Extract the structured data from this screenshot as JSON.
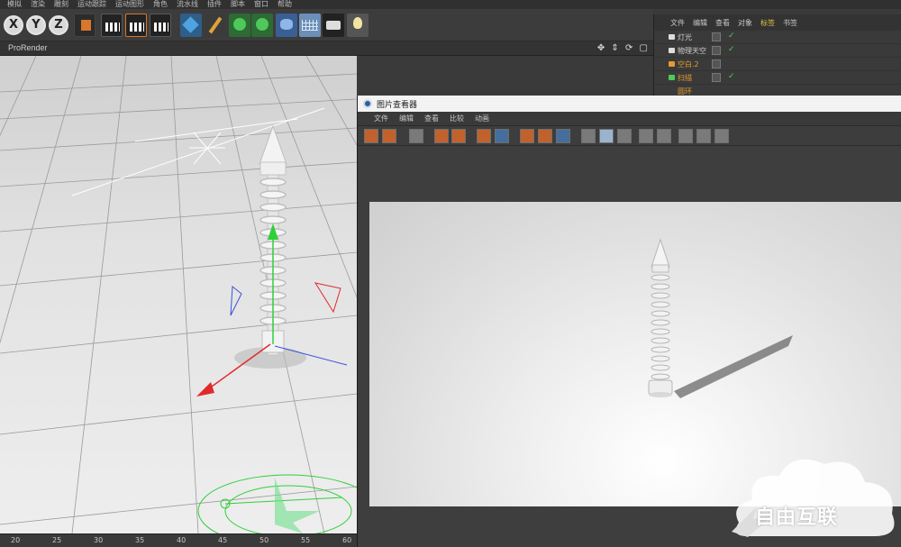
{
  "menubar": {
    "items": [
      "模拟",
      "渲染",
      "雕刻",
      "运动跟踪",
      "运动图形",
      "角色",
      "流水线",
      "插件",
      "脚本",
      "窗口",
      "帮助"
    ]
  },
  "toolbar": {
    "axis_x": "X",
    "axis_y": "Y",
    "axis_z": "Z",
    "icons": [
      "coordinate-system-icon",
      "render-view-icon",
      "render-picture-viewer-icon",
      "render-settings-icon",
      "cube-icon",
      "pen-icon",
      "subdivision-icon",
      "array-icon",
      "deformer-icon",
      "floor-icon",
      "camera-icon",
      "light-icon"
    ]
  },
  "viewport": {
    "title": "ProRender",
    "controls": "✥ ⇕ ⟳ ▢"
  },
  "ruler": {
    "ticks": [
      "20",
      "25",
      "30",
      "35",
      "40",
      "45",
      "50",
      "55",
      "60"
    ]
  },
  "object_manager": {
    "menu": [
      "文件",
      "编辑",
      "查看",
      "对象",
      "标签",
      "书签"
    ],
    "active_menu": "标签",
    "rows": [
      {
        "name": "灯光",
        "orange": false
      },
      {
        "name": "物理天空",
        "orange": false
      },
      {
        "name": "空白.2",
        "orange": true
      },
      {
        "name": "扫描",
        "orange": true
      },
      {
        "name": "圆环",
        "orange": true
      }
    ]
  },
  "picture_viewer": {
    "title": "图片查看器",
    "menu": [
      "文件",
      "编辑",
      "查看",
      "比较",
      "动画"
    ]
  },
  "colors": {
    "ui_bg": "#3a3a3a",
    "accent_orange": "#e59b2d",
    "accent_green": "#4ec95a",
    "axis_red": "#e02a2a",
    "axis_green": "#2fcf3a",
    "axis_blue": "#3a52d8"
  },
  "watermark": {
    "text": "自由互联"
  }
}
